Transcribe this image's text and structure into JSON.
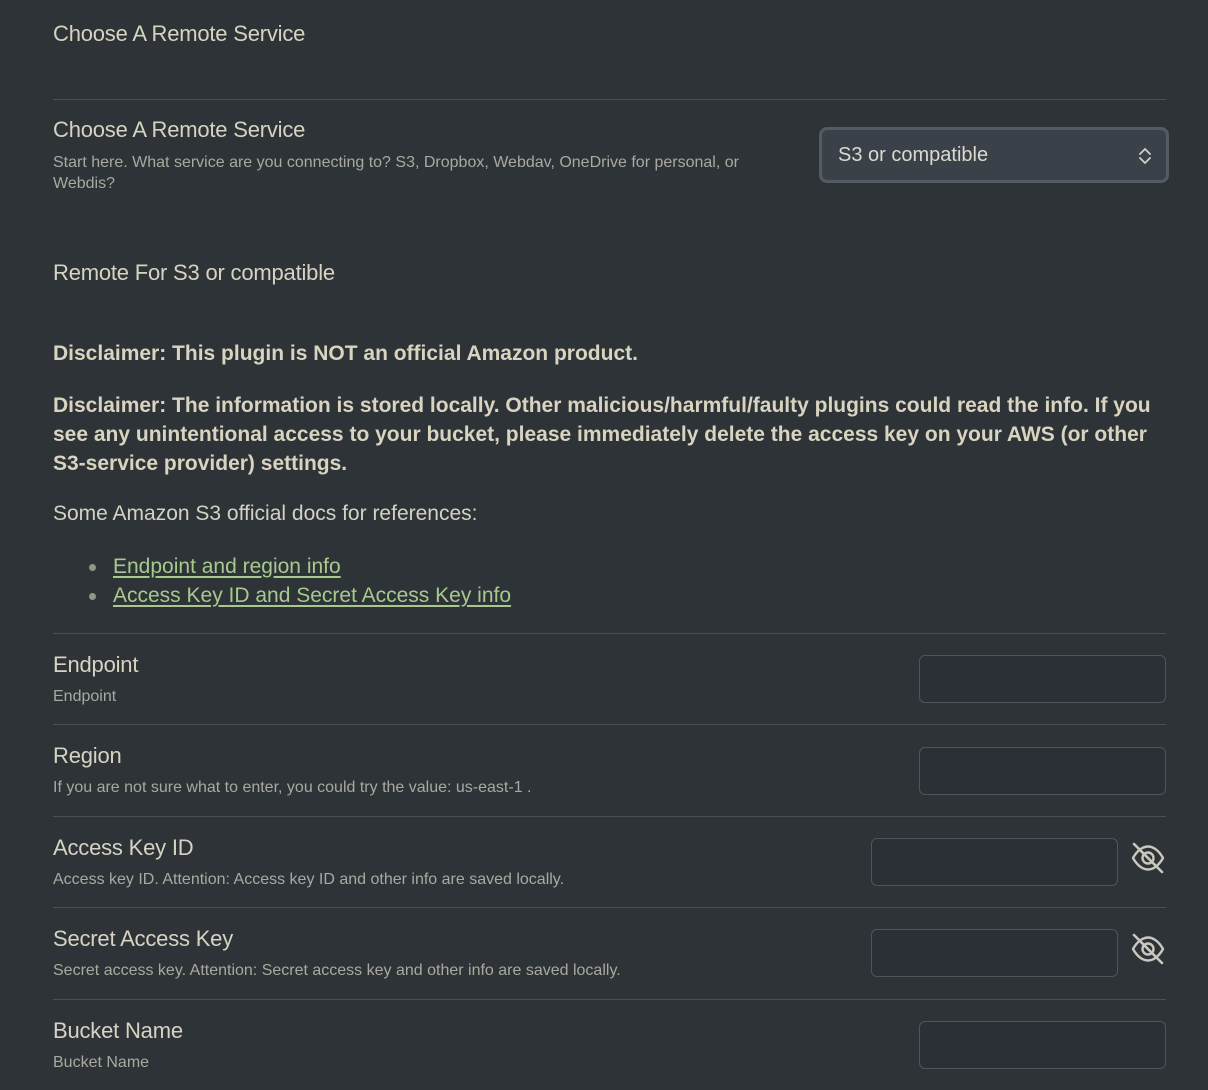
{
  "section_title": "Choose A Remote Service",
  "service_setting": {
    "name": "Choose A Remote Service",
    "description": "Start here. What service are you connecting to? S3, Dropbox, Webdav, OneDrive for personal, or Webdis?",
    "selected": "S3 or compatible"
  },
  "remote_title": "Remote For S3 or compatible",
  "disclaimers": [
    "Disclaimer: This plugin is NOT an official Amazon product.",
    "Disclaimer: The information is stored locally. Other malicious/harmful/faulty plugins could read the info. If you see any unintentional access to your bucket, please immediately delete the access key on your AWS (or other S3-service provider) settings."
  ],
  "docs": {
    "intro": "Some Amazon S3 official docs for references:",
    "links": [
      "Endpoint and region info",
      "Access Key ID and Secret Access Key info"
    ]
  },
  "settings": [
    {
      "name": "Endpoint",
      "description": "Endpoint",
      "value": ""
    },
    {
      "name": "Region",
      "description": "If you are not sure what to enter, you could try the value: us-east-1 .",
      "value": ""
    },
    {
      "name": "Access Key ID",
      "description": "Access key ID. Attention: Access key ID and other info are saved locally.",
      "value": "",
      "icon": "eye-off-icon"
    },
    {
      "name": "Secret Access Key",
      "description": "Secret access key. Attention: Secret access key and other info are saved locally.",
      "value": "",
      "icon": "eye-off-icon"
    },
    {
      "name": "Bucket Name",
      "description": "Bucket Name",
      "value": ""
    }
  ]
}
